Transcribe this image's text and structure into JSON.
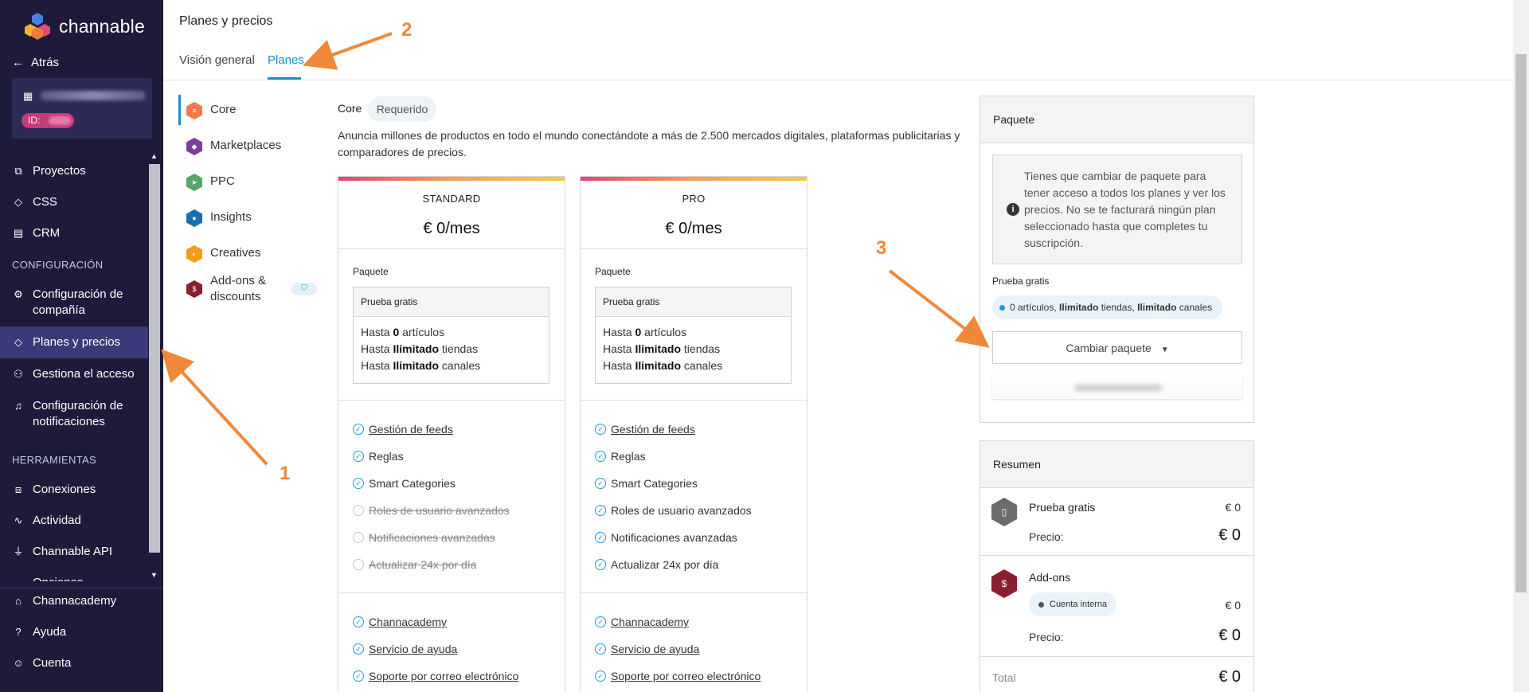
{
  "sidebar": {
    "brand": "channable",
    "back_label": "Atrás",
    "account_badge_prefix": "ID:",
    "nav_top": [
      {
        "label": "Proyectos",
        "icon": "folder-icon"
      },
      {
        "label": "CSS",
        "icon": "tag-icon"
      },
      {
        "label": "CRM",
        "icon": "document-icon"
      }
    ],
    "section_config": "CONFIGURACIÓN",
    "nav_config": [
      {
        "label": "Configuración de compañía",
        "icon": "gear-icon"
      },
      {
        "label": "Planes y precios",
        "icon": "price-tag-icon"
      },
      {
        "label": "Gestiona el acceso",
        "icon": "users-icon"
      },
      {
        "label": "Configuración de notificaciones",
        "icon": "bell-icon"
      }
    ],
    "section_tools": "HERRAMIENTAS",
    "nav_tools": [
      {
        "label": "Conexiones",
        "icon": "network-icon"
      },
      {
        "label": "Actividad",
        "icon": "activity-icon"
      },
      {
        "label": "Channable API",
        "icon": "plug-icon"
      },
      {
        "label": "Opciones",
        "icon": "options-icon"
      }
    ],
    "nav_bottom": [
      {
        "label": "Channacademy",
        "icon": "graduation-icon"
      },
      {
        "label": "Ayuda",
        "icon": "help-icon"
      },
      {
        "label": "Cuenta",
        "icon": "user-icon"
      }
    ]
  },
  "header": {
    "title": "Planes y precios",
    "tabs": [
      {
        "label": "Visión general"
      },
      {
        "label": "Planes"
      }
    ]
  },
  "categories": [
    {
      "label": "Core",
      "color": "#f07a4a"
    },
    {
      "label": "Marketplaces",
      "color": "#7a3e9d"
    },
    {
      "label": "PPC",
      "color": "#5aa66a"
    },
    {
      "label": "Insights",
      "color": "#1b6fb0"
    },
    {
      "label": "Creatives",
      "color": "#f39c1a"
    },
    {
      "label": "Add-ons & discounts",
      "color": "#8a1d2e"
    }
  ],
  "core": {
    "label": "Core",
    "badge": "Requerido",
    "description": "Anuncia millones de productos en todo el mundo conectándote a más de 2.500 mercados digitales, plataformas publicitarias y comparadores de precios."
  },
  "plans": [
    {
      "name": "STANDARD",
      "price": "€ 0/mes",
      "pkg_label": "Paquete",
      "pkg_name": "Prueba gratis",
      "limits": [
        {
          "pre": "Hasta ",
          "bold": "0",
          "post": " artículos"
        },
        {
          "pre": "Hasta ",
          "bold": "Ilimitado",
          "post": " tiendas"
        },
        {
          "pre": "Hasta ",
          "bold": "Ilimitado",
          "post": " canales"
        }
      ],
      "features": [
        {
          "label": "Gestión de feeds",
          "enabled": true,
          "link": true
        },
        {
          "label": "Reglas",
          "enabled": true,
          "link": false
        },
        {
          "label": "Smart Categories",
          "enabled": true,
          "link": false
        },
        {
          "label": "Roles de usuario avanzados",
          "enabled": false,
          "link": false
        },
        {
          "label": "Notificaciones avanzadas",
          "enabled": false,
          "link": false
        },
        {
          "label": "Actualizar 24x por día",
          "enabled": false,
          "link": false
        }
      ],
      "support": [
        {
          "label": "Channacademy"
        },
        {
          "label": "Servicio de ayuda"
        },
        {
          "label": "Soporte por correo electrónico"
        }
      ]
    },
    {
      "name": "PRO",
      "price": "€ 0/mes",
      "pkg_label": "Paquete",
      "pkg_name": "Prueba gratis",
      "limits": [
        {
          "pre": "Hasta ",
          "bold": "0",
          "post": " artículos"
        },
        {
          "pre": "Hasta ",
          "bold": "Ilimitado",
          "post": " tiendas"
        },
        {
          "pre": "Hasta ",
          "bold": "Ilimitado",
          "post": " canales"
        }
      ],
      "features": [
        {
          "label": "Gestión de feeds",
          "enabled": true,
          "link": true
        },
        {
          "label": "Reglas",
          "enabled": true,
          "link": false
        },
        {
          "label": "Smart Categories",
          "enabled": true,
          "link": false
        },
        {
          "label": "Roles de usuario avanzados",
          "enabled": true,
          "link": false
        },
        {
          "label": "Notificaciones avanzadas",
          "enabled": true,
          "link": false
        },
        {
          "label": "Actualizar 24x por día",
          "enabled": true,
          "link": false
        }
      ],
      "support": [
        {
          "label": "Channacademy"
        },
        {
          "label": "Servicio de ayuda"
        },
        {
          "label": "Soporte por correo electrónico"
        }
      ]
    }
  ],
  "package_panel": {
    "title": "Paquete",
    "info": "Tienes que cambiar de paquete para tener acceso a todos los planes y ver los precios. No se te facturará ningún plan seleccionado hasta que completes tu suscripción.",
    "pkg_label": "Prueba gratis",
    "chip_a": "0 artículos,",
    "chip_b": "Ilimitado",
    "chip_c": " tiendas, ",
    "chip_d": "Ilimitado",
    "chip_e": " canales",
    "change_button": "Cambiar paquete"
  },
  "summary": {
    "title": "Resumen",
    "rows": [
      {
        "name": "Prueba gratis",
        "amount": "€ 0",
        "price_label": "Precio:",
        "price": "€ 0"
      },
      {
        "name": "Add-ons",
        "chip": "Cuenta interna",
        "amount": "€ 0",
        "price_label": "Precio:",
        "price": "€ 0"
      }
    ],
    "total_label": "Total",
    "total": "€ 0"
  },
  "annotations": [
    "1",
    "2",
    "3"
  ],
  "colors": {
    "sidebar_bg": "#1d1a3a",
    "accent": "#1a8fc6",
    "annotation": "#f0883a"
  }
}
